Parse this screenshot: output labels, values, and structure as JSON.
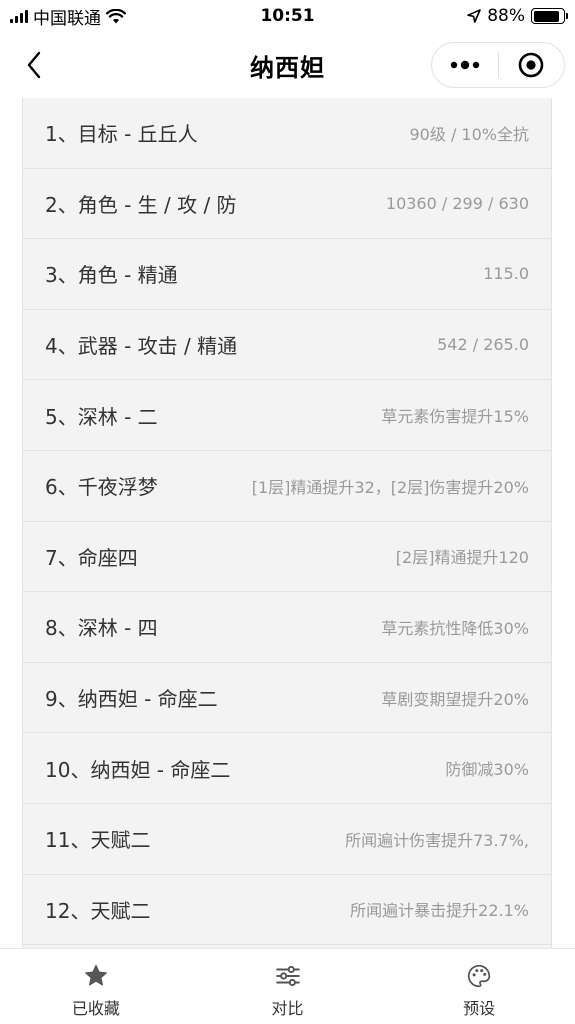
{
  "status_bar": {
    "carrier": "中国联通",
    "time": "10:51",
    "battery": "88%",
    "battery_level": 0.88,
    "icons": [
      "signal-icon",
      "wifi-icon",
      "location-icon",
      "battery-icon"
    ]
  },
  "nav": {
    "title": "纳西妲",
    "icons": [
      "back-chevron-icon",
      "more-dots-icon",
      "close-target-icon"
    ]
  },
  "rows": [
    {
      "label": "1、目标 - 丘丘人",
      "value": "90级 / 10%全抗"
    },
    {
      "label": "2、角色 - 生 / 攻 / 防",
      "value": "10360 / 299 / 630"
    },
    {
      "label": "3、角色 - 精通",
      "value": "115.0"
    },
    {
      "label": "4、武器 - 攻击 / 精通",
      "value": "542 / 265.0"
    },
    {
      "label": "5、深林 - 二",
      "value": "草元素伤害提升15%"
    },
    {
      "label": "6、千夜浮梦",
      "value": "[1层]精通提升32，[2层]伤害提升20%"
    },
    {
      "label": "7、命座四",
      "value": "[2层]精通提升120"
    },
    {
      "label": "8、深林 - 四",
      "value": "草元素抗性降低30%"
    },
    {
      "label": "9、纳西妲 - 命座二",
      "value": "草剧变期望提升20%"
    },
    {
      "label": "10、纳西妲 - 命座二",
      "value": "防御减30%"
    },
    {
      "label": "11、天赋二",
      "value": "所闻遍计伤害提升73.7%,"
    },
    {
      "label": "12、天赋二",
      "value": "所闻遍计暴击提升22.1%"
    }
  ],
  "tabs": [
    {
      "label": "已收藏",
      "icon": "star-icon"
    },
    {
      "label": "对比",
      "icon": "sliders-icon"
    },
    {
      "label": "预设",
      "icon": "palette-icon"
    }
  ]
}
